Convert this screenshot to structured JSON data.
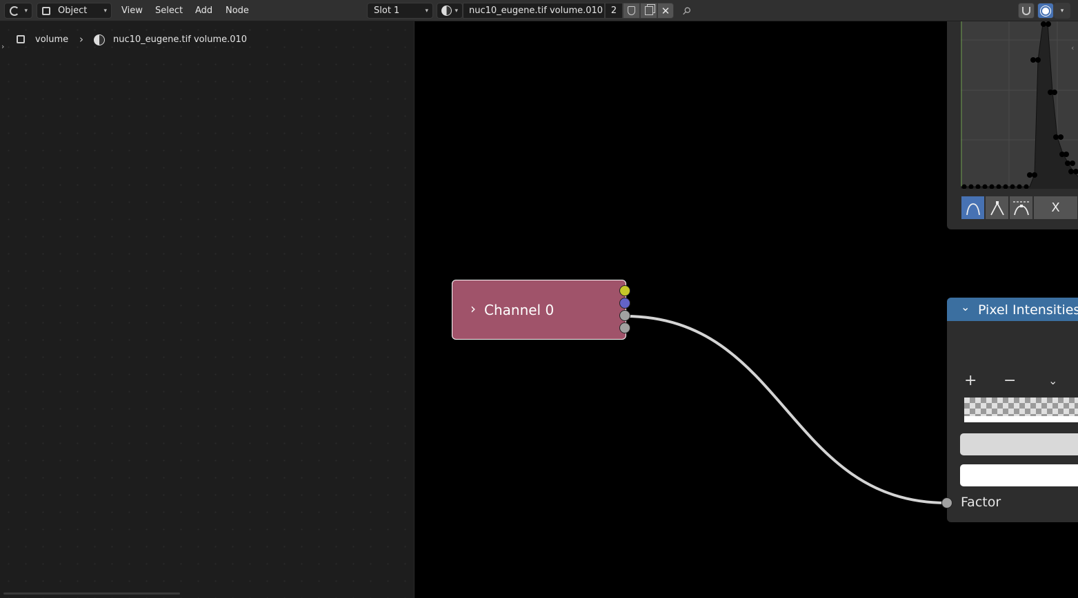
{
  "header": {
    "editor_type_icon": "node-editor-icon",
    "mode": "Object",
    "menus": [
      "View",
      "Select",
      "Add",
      "Node"
    ],
    "slot": "Slot 1",
    "material_name": "nuc10_eugene.tif volume.010",
    "user_count": "2"
  },
  "breadcrumb": {
    "object": "volume",
    "material": "nuc10_eugene.tif volume.010"
  },
  "channel_node": {
    "label": "Channel 0",
    "socket_colors": [
      "#c7c729",
      "#6363c7",
      "#a1a1a1",
      "#a1a1a1"
    ]
  },
  "curve_panel": {
    "tools": [
      "curve-smooth-icon",
      "curve-vector-icon",
      "curve-extend-icon"
    ],
    "tool_x_label": "X"
  },
  "pixel_node": {
    "title": "Pixel Intensities",
    "add_label": "+",
    "remove_label": "−",
    "factor_label": "Factor",
    "colors": {
      "header": "#3b6fa0",
      "color_field": "#d9d9d9",
      "pos_field": "#ffffff"
    }
  }
}
